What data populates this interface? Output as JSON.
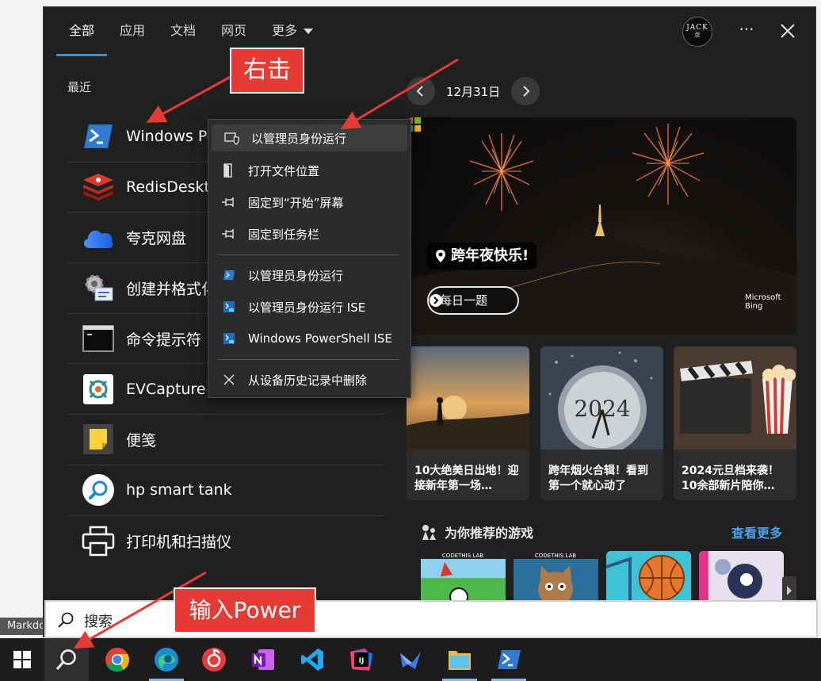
{
  "tabs": [
    {
      "label": "全部",
      "active": true
    },
    {
      "label": "应用"
    },
    {
      "label": "文档"
    },
    {
      "label": "网页"
    },
    {
      "label": "更多"
    }
  ],
  "header": {
    "avatar_text": "JACK",
    "avatar_subtext": "盘",
    "more_label": "···"
  },
  "recent": {
    "title": "最近",
    "items": [
      {
        "label": "Windows Po",
        "icon": "powershell-icon"
      },
      {
        "label": "RedisDeskto",
        "icon": "redis-icon"
      },
      {
        "label": "夸克网盘",
        "icon": "cloud-icon"
      },
      {
        "label": "创建并格式化",
        "icon": "disk-management-icon"
      },
      {
        "label": "命令提示符",
        "icon": "cmd-icon"
      },
      {
        "label": "EVCapture",
        "icon": "evcapture-icon"
      },
      {
        "label": "便笺",
        "icon": "sticky-notes-icon"
      },
      {
        "label": "hp smart tank",
        "icon": "hp-smart-icon"
      },
      {
        "label": "打印机和扫描仪",
        "icon": "printer-icon"
      }
    ]
  },
  "context_menu": {
    "items": [
      {
        "label": "以管理员身份运行",
        "icon": "shield-icon"
      },
      {
        "label": "打开文件位置",
        "icon": "folder-door-icon"
      },
      {
        "label": "固定到“开始”屏幕",
        "icon": "pin-icon"
      },
      {
        "label": "固定到任务栏",
        "icon": "pin-icon"
      },
      {
        "label": "以管理员身份运行",
        "icon": "powershell-icon"
      },
      {
        "label": "以管理员身份运行 ISE",
        "icon": "powershell-ise-icon"
      },
      {
        "label": "Windows PowerShell ISE",
        "icon": "powershell-ise-icon"
      },
      {
        "label": "从设备历史记录中删除",
        "icon": "close-icon"
      }
    ]
  },
  "highlights": {
    "date": "12月31日",
    "hero_tag": "跨年夜快乐!",
    "hero_quiz": "每日一题",
    "brand_line1": "Microsoft",
    "brand_line2": "Bing",
    "cards": [
      {
        "caption": "10大绝美日出地！迎接新年第一场…"
      },
      {
        "caption": "跨年烟火合辑！看到第一个就心动了"
      },
      {
        "caption": "2024元旦档来袭！10余部新片陪你…"
      }
    ],
    "games_title": "为你推荐的游戏",
    "see_more": "查看更多",
    "game_brand": "CODETHIS LAB",
    "card2_number": "2024"
  },
  "search": {
    "placeholder": "搜索"
  },
  "background_tab": "Markdo",
  "taskbar": {
    "items": [
      "start-icon",
      "search-icon",
      "chrome-icon",
      "edge-icon",
      "netease-music-icon",
      "onenote-icon",
      "vscode-icon",
      "intellij-icon",
      "feishu-icon",
      "file-explorer-icon",
      "powershell-icon"
    ]
  },
  "annotations": {
    "callout_right_click": "右击",
    "callout_type": "输入Power"
  },
  "colors": {
    "panel_bg": "#202020",
    "accent": "#3a8fd8",
    "link": "#4aa3ea",
    "callout": "#e63a35"
  }
}
